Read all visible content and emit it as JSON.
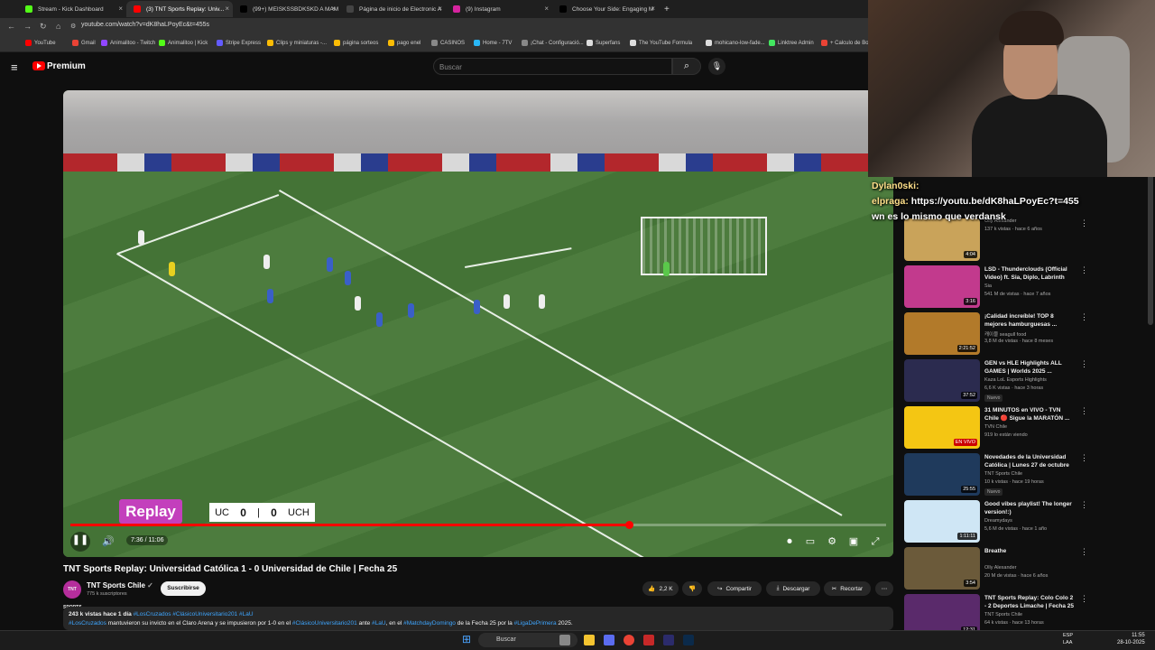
{
  "browser": {
    "tabs": [
      {
        "label": "Stream - Kick Dashboard",
        "color": "#53fc18"
      },
      {
        "label": "(3) TNT Sports Replay: Univ...",
        "color": "#ff0000"
      },
      {
        "label": "(99+) MEISKSSBDKSKD A MAM",
        "color": "#000000"
      },
      {
        "label": "Página de inicio de Electronic A",
        "color": "#444444"
      },
      {
        "label": "(9) Instagram",
        "color": "#d6249f"
      },
      {
        "label": "Choose Your Side: Engaging M",
        "color": "#000000"
      }
    ],
    "url": "youtube.com/watch?v=dK8haLPoyEc&t=455s",
    "bookmarks": [
      {
        "label": "YouTube",
        "color": "#ff0000"
      },
      {
        "label": "Gmail",
        "color": "#ea4335"
      },
      {
        "label": "Animalitoo - Twitch",
        "color": "#9146ff"
      },
      {
        "label": "Animalitoo | Kick",
        "color": "#53fc18"
      },
      {
        "label": "Stripe Express",
        "color": "#635bff"
      },
      {
        "label": "Clips y miniaturas -...",
        "color": "#fbbc05"
      },
      {
        "label": "página sorteos",
        "color": "#fbbc05"
      },
      {
        "label": "pago enel",
        "color": "#fbbc05"
      },
      {
        "label": "CASINOS",
        "color": "#888888"
      },
      {
        "label": "Home - 7TV",
        "color": "#29b6f6"
      },
      {
        "label": "¡Chat - Configuració...",
        "color": "#888888"
      },
      {
        "label": "Superfans",
        "color": "#dddddd"
      },
      {
        "label": "The YouTube Formula",
        "color": "#dddddd"
      },
      {
        "label": "mohicano-low-fade...",
        "color": "#dddddd"
      },
      {
        "label": "Linktree Admin",
        "color": "#43e660"
      },
      {
        "label": "+ Calculo de Bo",
        "color": "#ea4335"
      }
    ]
  },
  "youtube": {
    "brand": "Premium",
    "search_placeholder": "Buscar"
  },
  "player": {
    "replay_logo": "Replay",
    "score": {
      "home": "UC",
      "home_goals": "0",
      "away_goals": "0",
      "away": "UCH"
    },
    "timecode": "7:36 / 11:06",
    "progress": 0.685
  },
  "video": {
    "title": "TNT Sports Replay: Universidad Católica 1 - 0 Universidad de Chile | Fecha 25",
    "channel": "TNT Sports Chile",
    "channel_avatar": "TNT SPORTS",
    "subscribers": "775 k suscriptores",
    "subscribe_label": "Suscribirse",
    "likes": "2,2 K",
    "share_label": "Compartir",
    "download_label": "Descargar",
    "clip_label": "Recortar",
    "desc_stats": "243 k vistas  hace 1 día",
    "desc_tags": "#LosCruzados #ClásicoUniversitario201 #LaU",
    "desc_text_1": "#LosCruzados",
    "desc_text_2": " mantuvieron su invicto en el Claro Arena y se impusieron por 1-0 en el ",
    "desc_text_3": "#ClásicoUniversitario201",
    "desc_text_4": " ante ",
    "desc_text_5": "#LaU",
    "desc_text_6": ", en el ",
    "desc_text_7": "#MatchdayDomingo",
    "desc_text_8": " de la Fecha 25 por la ",
    "desc_text_9": "#LigaDePrimera",
    "desc_text_10": " 2025."
  },
  "chat": [
    {
      "user": "Dylan0ski:",
      "text": "",
      "color": "#ffffff"
    },
    {
      "user": "elpraga:",
      "text": " https://youtu.be/dK8haLPoyEc?t=455",
      "color": "#ffffff"
    },
    {
      "user": "",
      "text": "wn es lo mismo que verdansk",
      "color": "#ffffff"
    }
  ],
  "recommended": [
    {
      "title": "",
      "channel": "Olly Alexander",
      "meta": "137 k vistas · hace 6 años",
      "duration": "4:04",
      "badge": "",
      "thumb": "#c9a35a"
    },
    {
      "title": "LSD - Thunderclouds (Official Video) ft. Sia, Diplo, Labrinth",
      "channel": "Sia",
      "meta": "541 M de vistas · hace 7 años",
      "duration": "3:16",
      "badge": "",
      "thumb": "#c23a8d"
    },
    {
      "title": "¡Calidad increíble! TOP 8 mejores hamburguesas ...",
      "channel": "캐이블 seagull food",
      "meta": "3,8 M de vistas · hace 8 meses",
      "duration": "2:21:52",
      "badge": "",
      "thumb": "#b27a2a"
    },
    {
      "title": "GEN vs HLE Highlights ALL GAMES | Worlds 2025 ...",
      "channel": "Kaza LoL Esports Highlights",
      "meta": "6,6 K vistas · hace 3 horas",
      "duration": "37:52",
      "badge": "Nuevo",
      "thumb": "#2b2b4f"
    },
    {
      "title": "31 MINUTOS en VIVO - TVN Chile 🔴 Sigue la MARATÓN ...",
      "channel": "TVN Chile",
      "meta": "919 lo están viendo",
      "duration": "EN VIVO",
      "badge": "",
      "thumb": "#f4c613"
    },
    {
      "title": "Novedades de la Universidad Católica | Lunes 27 de octubre",
      "channel": "TNT Sports Chile",
      "meta": "10 k vistas · hace 19 horas",
      "duration": "25:55",
      "badge": "Nuevo",
      "thumb": "#1f3a5c"
    },
    {
      "title": "Good vibes playlist! The longer version!:)",
      "channel": "Dreamydays",
      "meta": "5,6 M de vistas · hace 1 año",
      "duration": "1:11:11",
      "badge": "",
      "thumb": "#cfe6f5"
    },
    {
      "title": "Breathe",
      "channel": "Olly Alexander",
      "meta": "20 M de vistas · hace 6 años",
      "duration": "3:54",
      "badge": "",
      "thumb": "#6b5a3a"
    },
    {
      "title": "TNT Sports Replay: Colo Colo 2 - 2 Deportes Limache | Fecha 25",
      "channel": "TNT Sports Chile",
      "meta": "64 k vistas · hace 13 horas",
      "duration": "12:31",
      "badge": "",
      "thumb": "#5a2a6b"
    }
  ],
  "taskbar": {
    "search_label": "Buscar",
    "lang": "ESP\nLAA",
    "time": "11:55",
    "date": "28-10-2025"
  }
}
